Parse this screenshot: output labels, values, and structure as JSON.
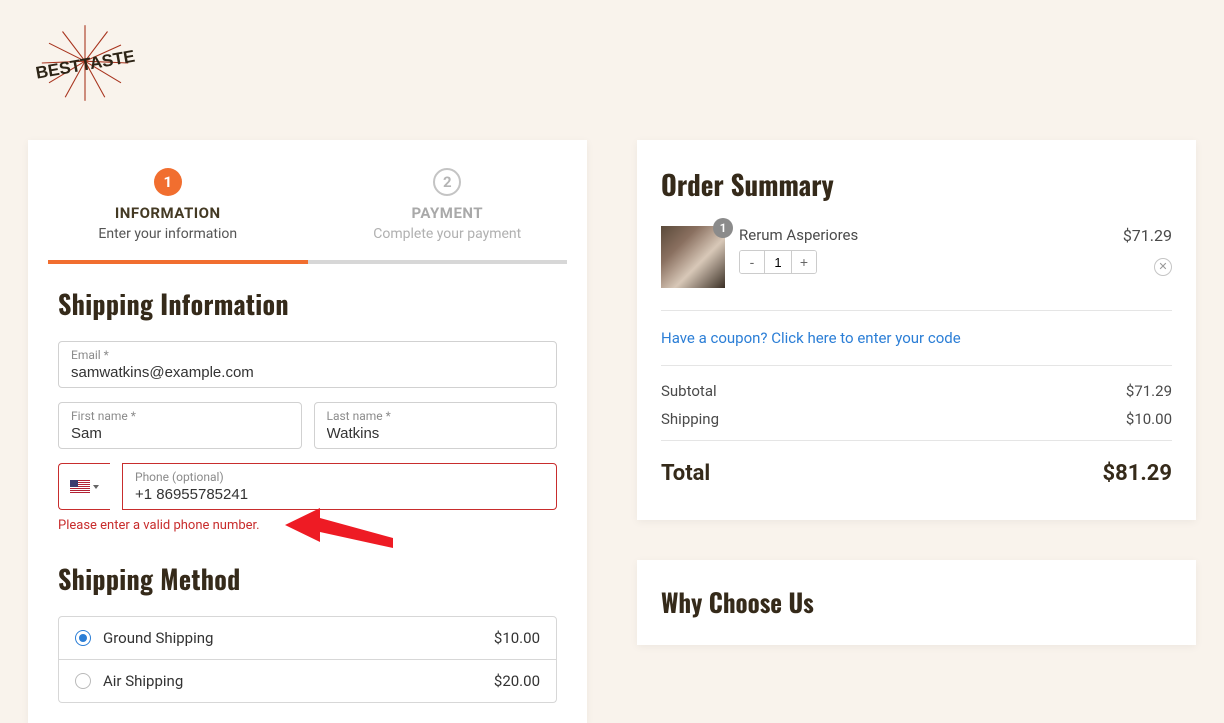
{
  "logo_text": "BESTTASTE",
  "steps": [
    {
      "num": "1",
      "title": "INFORMATION",
      "sub": "Enter your information"
    },
    {
      "num": "2",
      "title": "PAYMENT",
      "sub": "Complete your payment"
    }
  ],
  "shipping_info": {
    "heading": "Shipping Information",
    "email_label": "Email *",
    "email_value": "samwatkins@example.com",
    "first_label": "First name *",
    "first_value": "Sam",
    "last_label": "Last name *",
    "last_value": "Watkins",
    "phone_label": "Phone (optional)",
    "phone_value": "+1 86955785241",
    "phone_error": "Please enter a valid phone number."
  },
  "shipping_method": {
    "heading": "Shipping Method",
    "options": [
      {
        "label": "Ground Shipping",
        "price": "$10.00"
      },
      {
        "label": "Air Shipping",
        "price": "$20.00"
      }
    ]
  },
  "order": {
    "heading": "Order Summary",
    "item": {
      "name": "Rerum Asperiores",
      "badge": "1",
      "qty": "1",
      "price": "$71.29"
    },
    "coupon_text": "Have a coupon? Click here to enter your code",
    "subtotal_label": "Subtotal",
    "subtotal_value": "$71.29",
    "shipping_label": "Shipping",
    "shipping_value": "$10.00",
    "total_label": "Total",
    "total_value": "$81.29"
  },
  "why_heading": "Why Choose Us"
}
